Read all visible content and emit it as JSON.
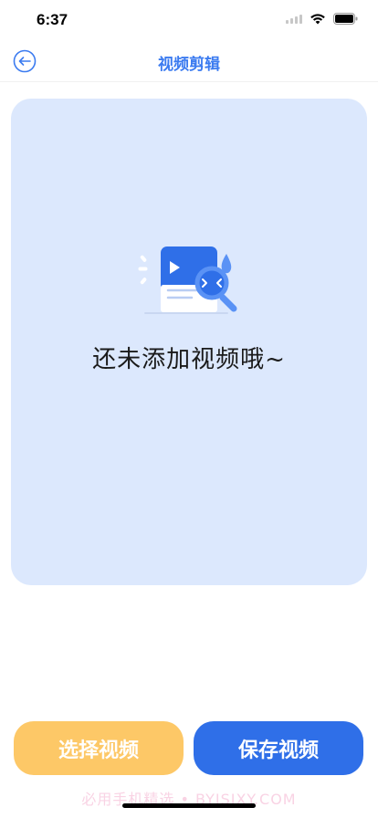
{
  "status_bar": {
    "time": "6:37"
  },
  "nav": {
    "title": "视频剪辑",
    "back_icon": "back-arrow-circle-icon"
  },
  "preview": {
    "empty_text": "还未添加视频哦~",
    "illustration_icon": "video-search-icon"
  },
  "actions": {
    "select_label": "选择视频",
    "save_label": "保存视频"
  },
  "watermark": "必用手机精选 • BYJSJXY.COM",
  "colors": {
    "accent": "#3b7bf0",
    "card_bg": "#dce8fd",
    "select_btn": "#fdc867",
    "save_btn": "#2f6fe8"
  }
}
